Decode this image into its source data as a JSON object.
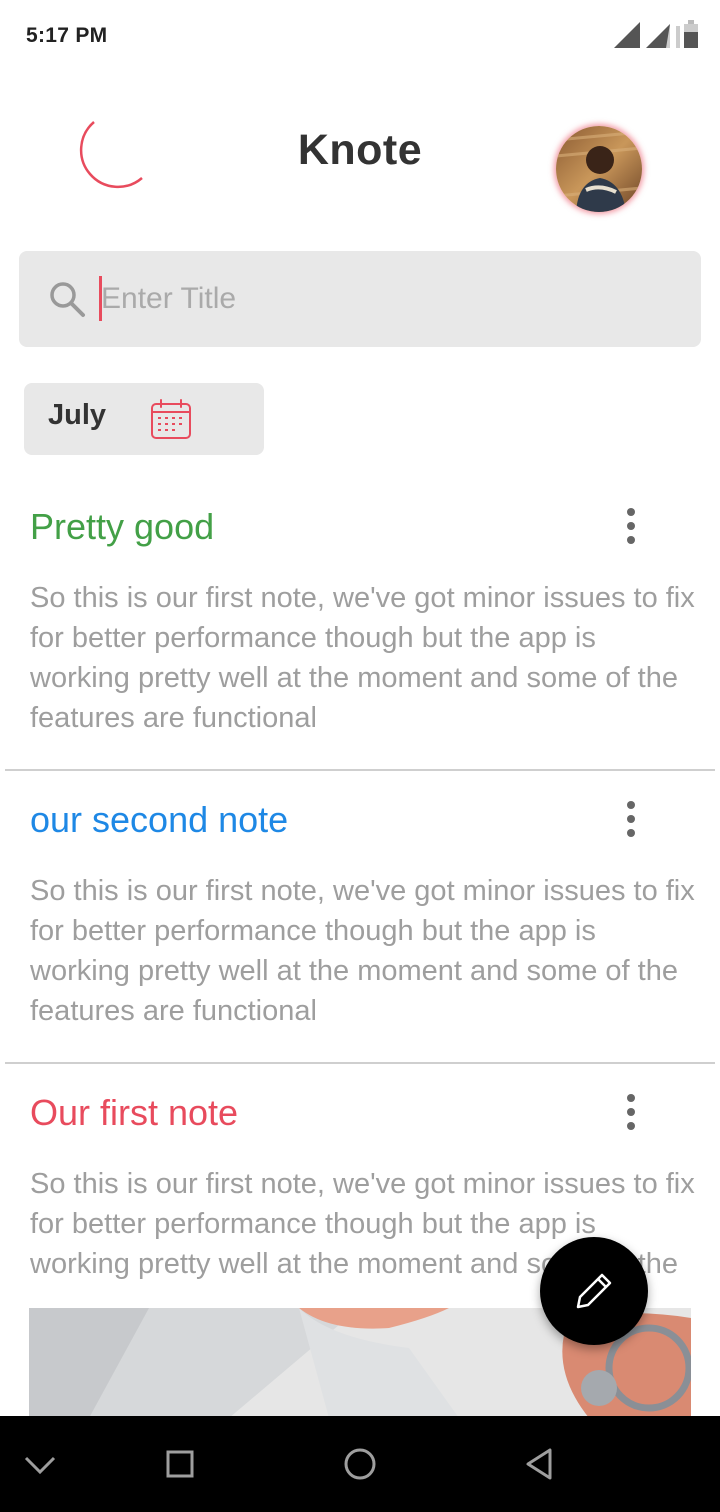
{
  "status_bar": {
    "time": "5:17 PM"
  },
  "header": {
    "title": "Knote",
    "theme_icon": "moon-icon",
    "avatar_icon": "avatar"
  },
  "search": {
    "placeholder": "Enter Title",
    "value": "",
    "icon": "search-icon"
  },
  "filter": {
    "month": "July",
    "icon": "calendar-icon"
  },
  "notes": [
    {
      "title": "Pretty good",
      "title_color": "#43a047",
      "body": "So this is our first note, we've got minor issues to fix for better performance though but the app is working pretty well at the moment and some of the features are functional"
    },
    {
      "title": "our second note",
      "title_color": "#1e88e5",
      "body": "So this is our first note, we've got minor issues to fix for better performance though but the app is working pretty well at the moment and some of the features are functional"
    },
    {
      "title": "Our first note",
      "title_color": "#e84b5d",
      "body": "So this is our first note, we've got minor issues to fix for better performance though but the app is working pretty well at the moment and some of the features are functional"
    }
  ],
  "fab": {
    "icon": "edit-icon"
  },
  "nav_bar": {
    "buttons": [
      "chevron-down-icon",
      "recents-icon",
      "home-icon",
      "back-icon"
    ]
  },
  "colors": {
    "accent": "#e84b5d",
    "muted_text": "#9e9e9e",
    "surface": "#e8e8e8"
  }
}
